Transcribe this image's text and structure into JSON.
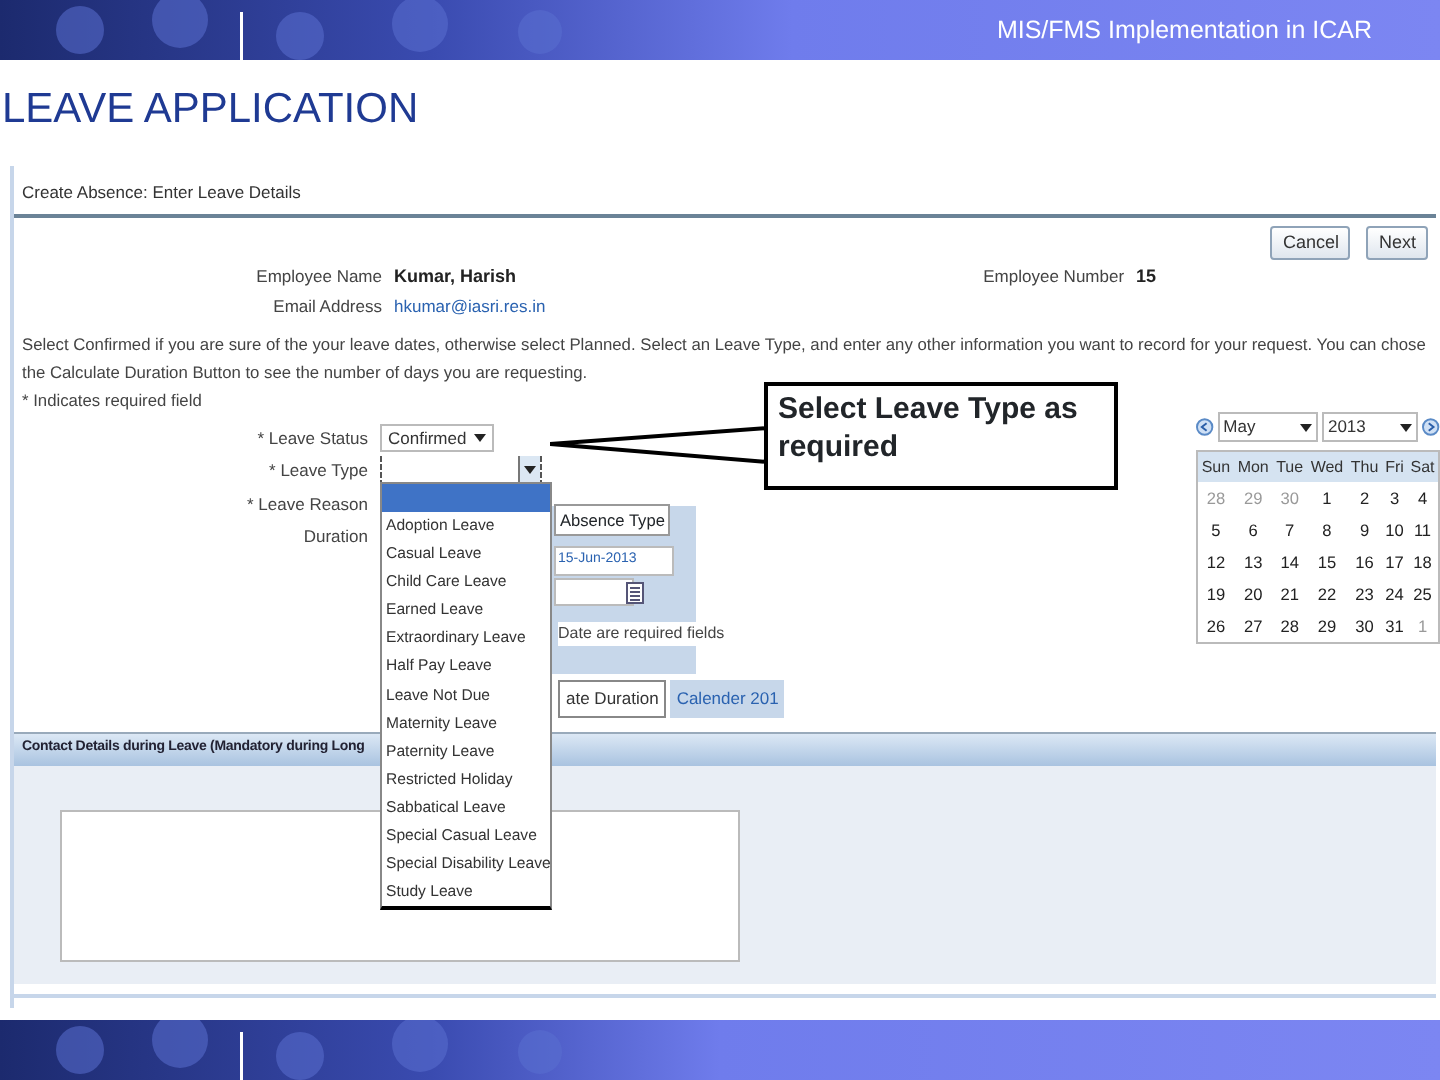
{
  "slide": {
    "header_text": "MIS/FMS Implementation in ICAR",
    "title": "LEAVE APPLICATION"
  },
  "app": {
    "page_title": "Create Absence: Enter Leave Details",
    "buttons": [
      {
        "label": "Cancel"
      },
      {
        "label": "Next"
      }
    ],
    "employee_name": {
      "label": "Employee Name",
      "value": "Kumar, Harish"
    },
    "email": {
      "label": "Email Address",
      "value": "hkumar@iasri.res.in"
    },
    "employee_number": {
      "label": "Employee Number",
      "value": "15"
    },
    "instructions": "Select Confirmed if you are sure of the your leave dates, otherwise select Planned. Select an Leave Type, and enter any other information you want to record for your request. You can chose the Calculate Duration Button to see the number of days you are requesting.",
    "required_note": "* Indicates required field",
    "fields": [
      {
        "label": "* Leave Status",
        "kind": "select",
        "value": "Confirmed"
      },
      {
        "label": "* Leave Type",
        "kind": "select-open"
      },
      {
        "label": "* Leave Reason",
        "kind": "label"
      },
      {
        "label": "Duration",
        "kind": "label"
      }
    ],
    "dropdown": {
      "blank_highlighted": true,
      "options": [
        "Adoption Leave",
        "Casual Leave",
        "Child Care Leave",
        "Earned Leave",
        "Extraordinary Leave",
        "Half Pay Leave",
        "Leave Not Due",
        "Maternity Leave",
        "Paternity Leave",
        "Restricted Holiday",
        "Sabbatical Leave",
        "Special Casual Leave",
        "Special Disability Leave",
        "Study Leave"
      ]
    },
    "absence_panel": {
      "tooltip": "Absence Type",
      "date": "15-Jun-2013",
      "note": "Date are required fields",
      "buttons": [
        "ate Duration",
        "Calender 201"
      ]
    },
    "contact": {
      "heading": "Contact Details during Leave (Mandatory during Long"
    },
    "callout": "Select Leave Type as required",
    "calendar": {
      "month": "May",
      "year": "2013",
      "weekdays": [
        "Sun",
        "Mon",
        "Tue",
        "Wed",
        "Thu",
        "Fri",
        "Sat"
      ],
      "weeks": [
        [
          {
            "day": "28",
            "outside": true
          },
          {
            "day": "29",
            "outside": true
          },
          {
            "day": "30",
            "outside": true
          },
          {
            "day": "1",
            "outside": false
          },
          {
            "day": "2",
            "outside": false
          },
          {
            "day": "3",
            "outside": false
          },
          {
            "day": "4",
            "outside": false
          }
        ],
        [
          {
            "day": "5",
            "outside": false
          },
          {
            "day": "6",
            "outside": false
          },
          {
            "day": "7",
            "outside": false
          },
          {
            "day": "8",
            "outside": false
          },
          {
            "day": "9",
            "outside": false
          },
          {
            "day": "10",
            "outside": false
          },
          {
            "day": "11",
            "outside": false
          }
        ],
        [
          {
            "day": "12",
            "outside": false
          },
          {
            "day": "13",
            "outside": false
          },
          {
            "day": "14",
            "outside": false
          },
          {
            "day": "15",
            "outside": false
          },
          {
            "day": "16",
            "outside": false
          },
          {
            "day": "17",
            "outside": false
          },
          {
            "day": "18",
            "outside": false
          }
        ],
        [
          {
            "day": "19",
            "outside": false
          },
          {
            "day": "20",
            "outside": false
          },
          {
            "day": "21",
            "outside": false
          },
          {
            "day": "22",
            "outside": false
          },
          {
            "day": "23",
            "outside": false
          },
          {
            "day": "24",
            "outside": false
          },
          {
            "day": "25",
            "outside": false
          }
        ],
        [
          {
            "day": "26",
            "outside": false
          },
          {
            "day": "27",
            "outside": false
          },
          {
            "day": "28",
            "outside": false
          },
          {
            "day": "29",
            "outside": false
          },
          {
            "day": "30",
            "outside": false
          },
          {
            "day": "31",
            "outside": false
          },
          {
            "day": "1",
            "outside": true
          }
        ]
      ]
    }
  }
}
